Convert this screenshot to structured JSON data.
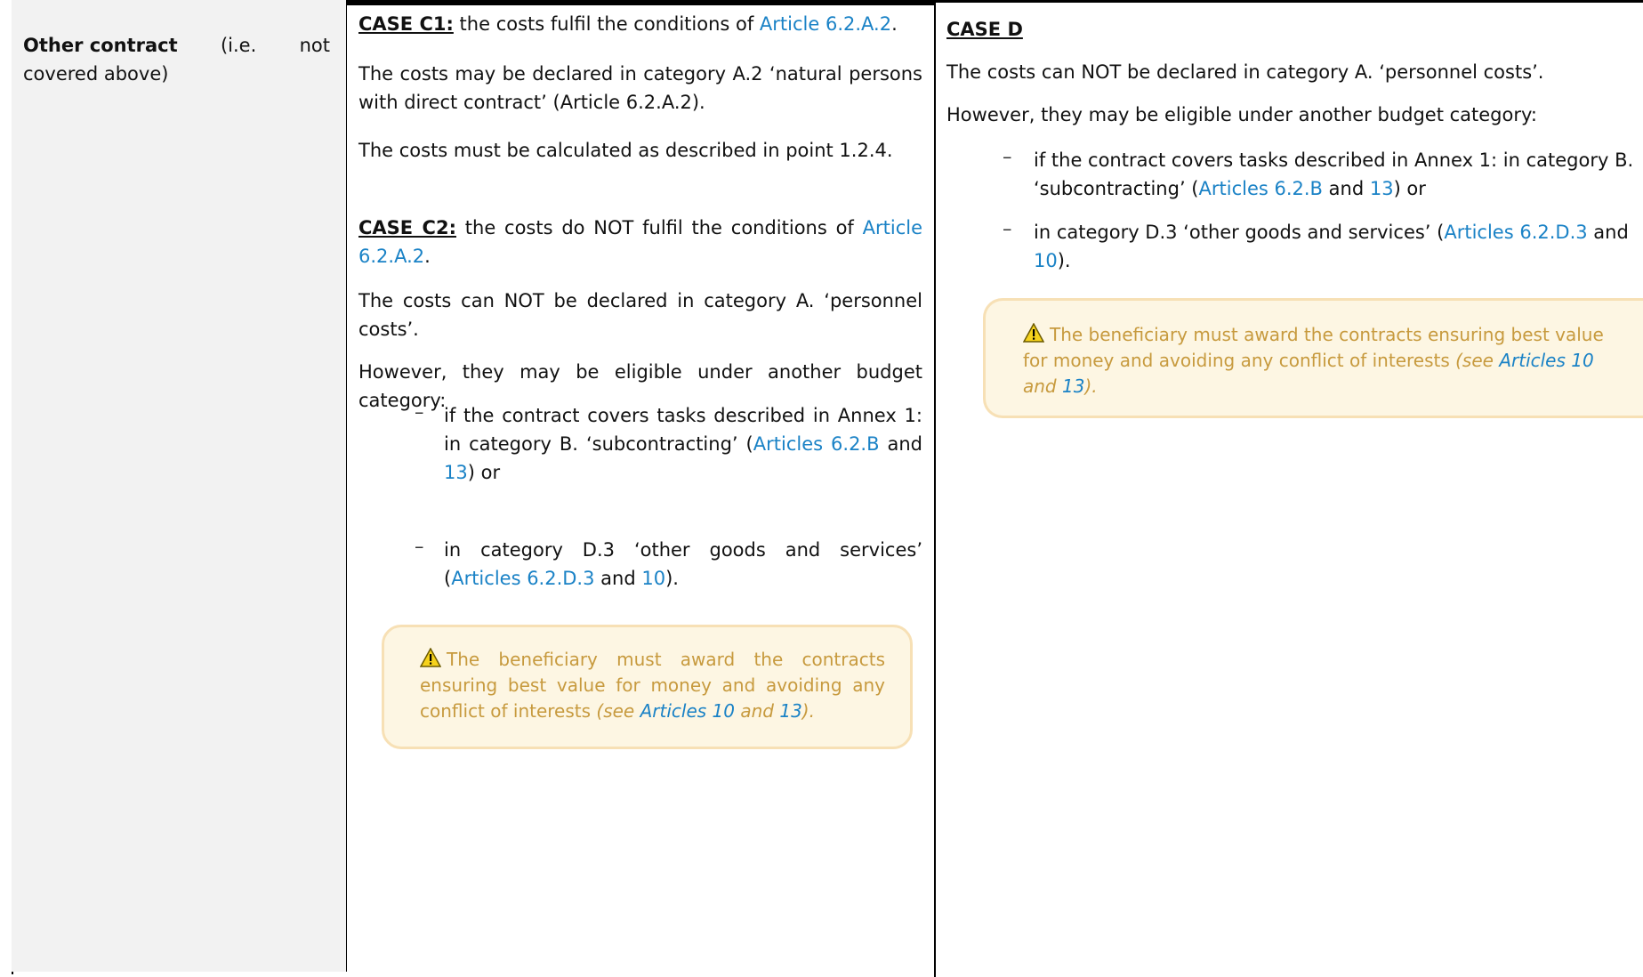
{
  "row_label": {
    "bold": "Other contract",
    "suffix_parts": [
      "(i.e.",
      "not"
    ],
    "line2": "covered above)"
  },
  "case_c1": {
    "title": "CASE C1:",
    "intro": " the costs fulfil the conditions of ",
    "link": "Article 6.2.A.2",
    "end": ".",
    "p2": "The costs may be declared in category A.2 ‘natural persons with direct contract’ (Article 6.2.A.2).",
    "p3": "The costs must be calculated as described in point 1.2.4."
  },
  "case_c2": {
    "title": "CASE C2:",
    "intro": " the costs do NOT fulfil the conditions of ",
    "link": "Article 6.2.A.2",
    "end": ".",
    "p2": "The costs can NOT be declared in category A. ‘personnel costs’.",
    "p3": "However, they may be eligible under another budget category:",
    "item1_pre": "if the contract covers tasks described in Annex 1: in category B. ‘subcontracting’ (",
    "item1_link1": "Articles 6.2.B",
    "item1_mid": " and ",
    "item1_link2": "13",
    "item1_end": ") or",
    "item2_pre": "in category D.3 ‘other goods and services’ (",
    "item2_link1": "Articles 6.2.D.3",
    "item2_mid": " and ",
    "item2_link2": "10",
    "item2_end": ").",
    "note_text": "The beneficiary must award the contracts ensuring best value for money and avoiding any conflict of interests ",
    "note_see": "(see ",
    "note_link1": "Articles 10",
    "note_and": " and ",
    "note_link2": "13",
    "note_end": ")."
  },
  "case_d": {
    "title": "CASE D",
    "p1": "The costs can NOT be declared in category A. ‘personnel costs’.",
    "p2": "However, they may be eligible under another budget category:",
    "item1_pre": "if the contract covers tasks described in Annex 1: in category B.",
    "item1_line2": "‘subcontracting’ (",
    "item1_link1": "Articles 6.2.B",
    "item1_mid": " and ",
    "item1_link2": "13",
    "item1_end": ") or",
    "item2_pre": "in category D.3 ‘other goods and services’ (",
    "item2_link1": "Articles 6.2.D.3",
    "item2_mid": " and",
    "item2_line2_link": "10",
    "item2_end": ").",
    "note_text": "The beneficiary must award the contracts ensuring best value for money and avoiding any conflict of interests ",
    "note_see": "(see ",
    "note_link1": "Articles 10",
    "note_and": " and ",
    "note_link2": "13",
    "note_end": ")."
  },
  "dash_glyph": "–",
  "colors": {
    "link": "#1a82c6",
    "note_text": "#c79a3e",
    "note_bg": "#fdf6e3",
    "note_border": "#f7e0b5",
    "label_bg": "#f2f2f2"
  },
  "icons": {
    "warning": "warning-icon"
  }
}
